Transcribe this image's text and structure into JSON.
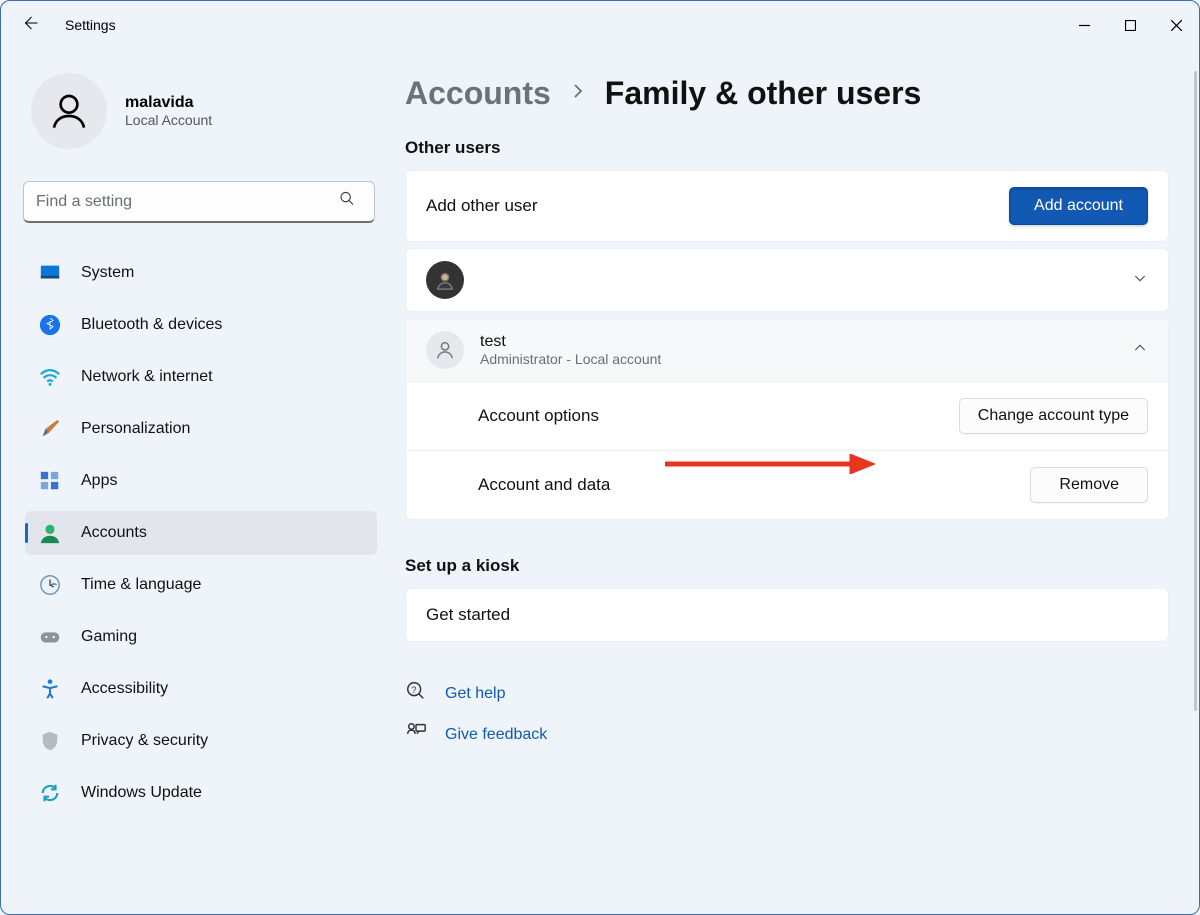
{
  "app_title": "Settings",
  "profile": {
    "name": "malavida",
    "subtitle": "Local Account"
  },
  "search": {
    "placeholder": "Find a setting"
  },
  "nav": {
    "items": [
      {
        "label": "System",
        "icon": "system"
      },
      {
        "label": "Bluetooth & devices",
        "icon": "bluetooth"
      },
      {
        "label": "Network & internet",
        "icon": "wifi"
      },
      {
        "label": "Personalization",
        "icon": "brush"
      },
      {
        "label": "Apps",
        "icon": "apps"
      },
      {
        "label": "Accounts",
        "icon": "accounts",
        "selected": true
      },
      {
        "label": "Time & language",
        "icon": "time"
      },
      {
        "label": "Gaming",
        "icon": "gaming"
      },
      {
        "label": "Accessibility",
        "icon": "accessibility"
      },
      {
        "label": "Privacy & security",
        "icon": "privacy"
      },
      {
        "label": "Windows Update",
        "icon": "update"
      }
    ]
  },
  "breadcrumb": {
    "parent": "Accounts",
    "current": "Family & other users"
  },
  "sections": {
    "other_users_title": "Other users",
    "add_other_user_label": "Add other user",
    "add_account_button": "Add account",
    "account2": {
      "name": "test",
      "subtitle": "Administrator - Local account",
      "option_row": "Account options",
      "option_button": "Change account type",
      "data_row": "Account and data",
      "data_button": "Remove"
    },
    "kiosk_title": "Set up a kiosk",
    "kiosk_row": "Get started",
    "help_link": "Get help",
    "feedback_link": "Give feedback"
  }
}
